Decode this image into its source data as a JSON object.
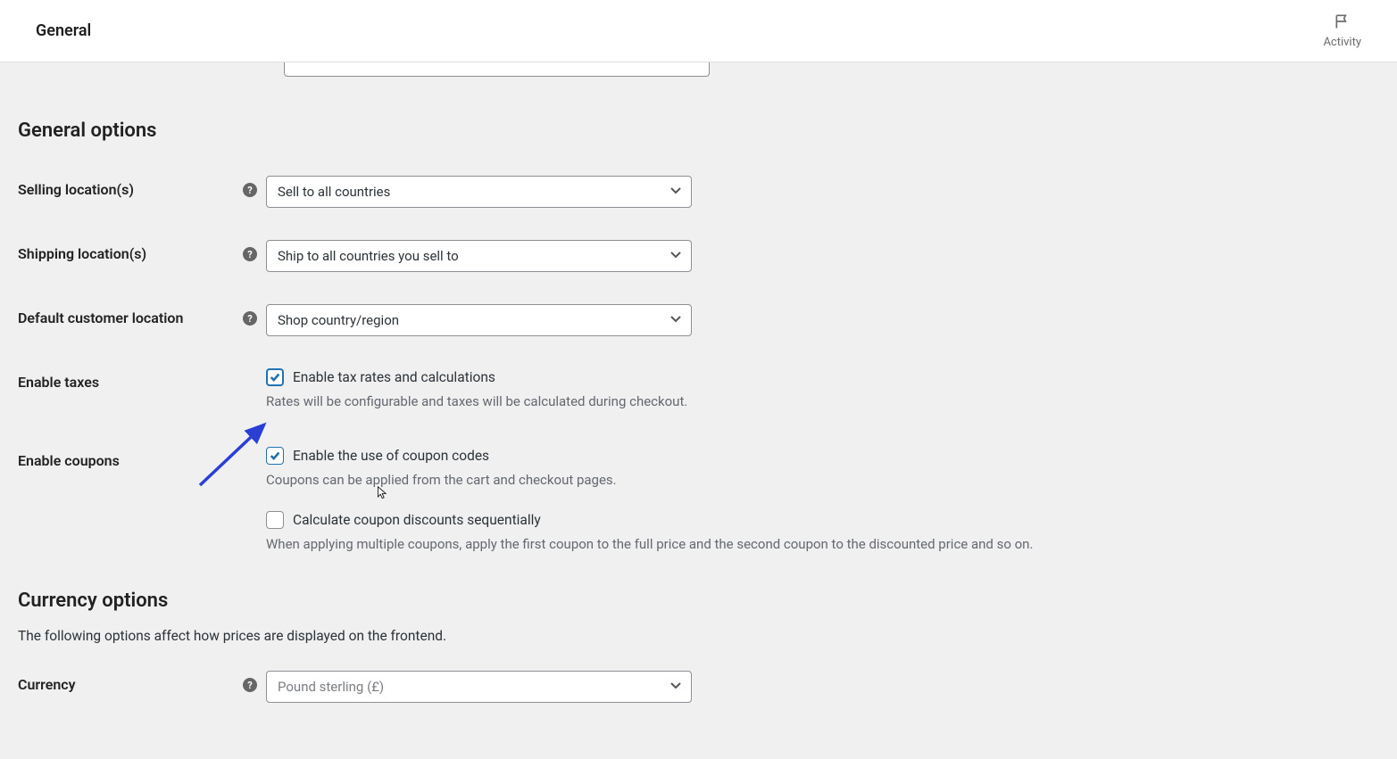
{
  "topbar": {
    "title": "General",
    "activity_label": "Activity"
  },
  "sections": {
    "general_options_heading": "General options",
    "currency_options_heading": "Currency options",
    "currency_options_desc": "The following options affect how prices are displayed on the frontend."
  },
  "fields": {
    "selling_locations": {
      "label": "Selling location(s)",
      "value": "Sell to all countries"
    },
    "shipping_locations": {
      "label": "Shipping location(s)",
      "value": "Ship to all countries you sell to"
    },
    "default_customer_location": {
      "label": "Default customer location",
      "value": "Shop country/region"
    },
    "enable_taxes": {
      "label": "Enable taxes",
      "checkbox_label": "Enable tax rates and calculations",
      "desc": "Rates will be configurable and taxes will be calculated during checkout."
    },
    "enable_coupons": {
      "label": "Enable coupons",
      "checkbox1_label": "Enable the use of coupon codes",
      "desc1": "Coupons can be applied from the cart and checkout pages.",
      "checkbox2_label": "Calculate coupon discounts sequentially",
      "desc2": "When applying multiple coupons, apply the first coupon to the full price and the second coupon to the discounted price and so on."
    },
    "currency": {
      "label": "Currency",
      "value": "Pound sterling (£)"
    }
  }
}
